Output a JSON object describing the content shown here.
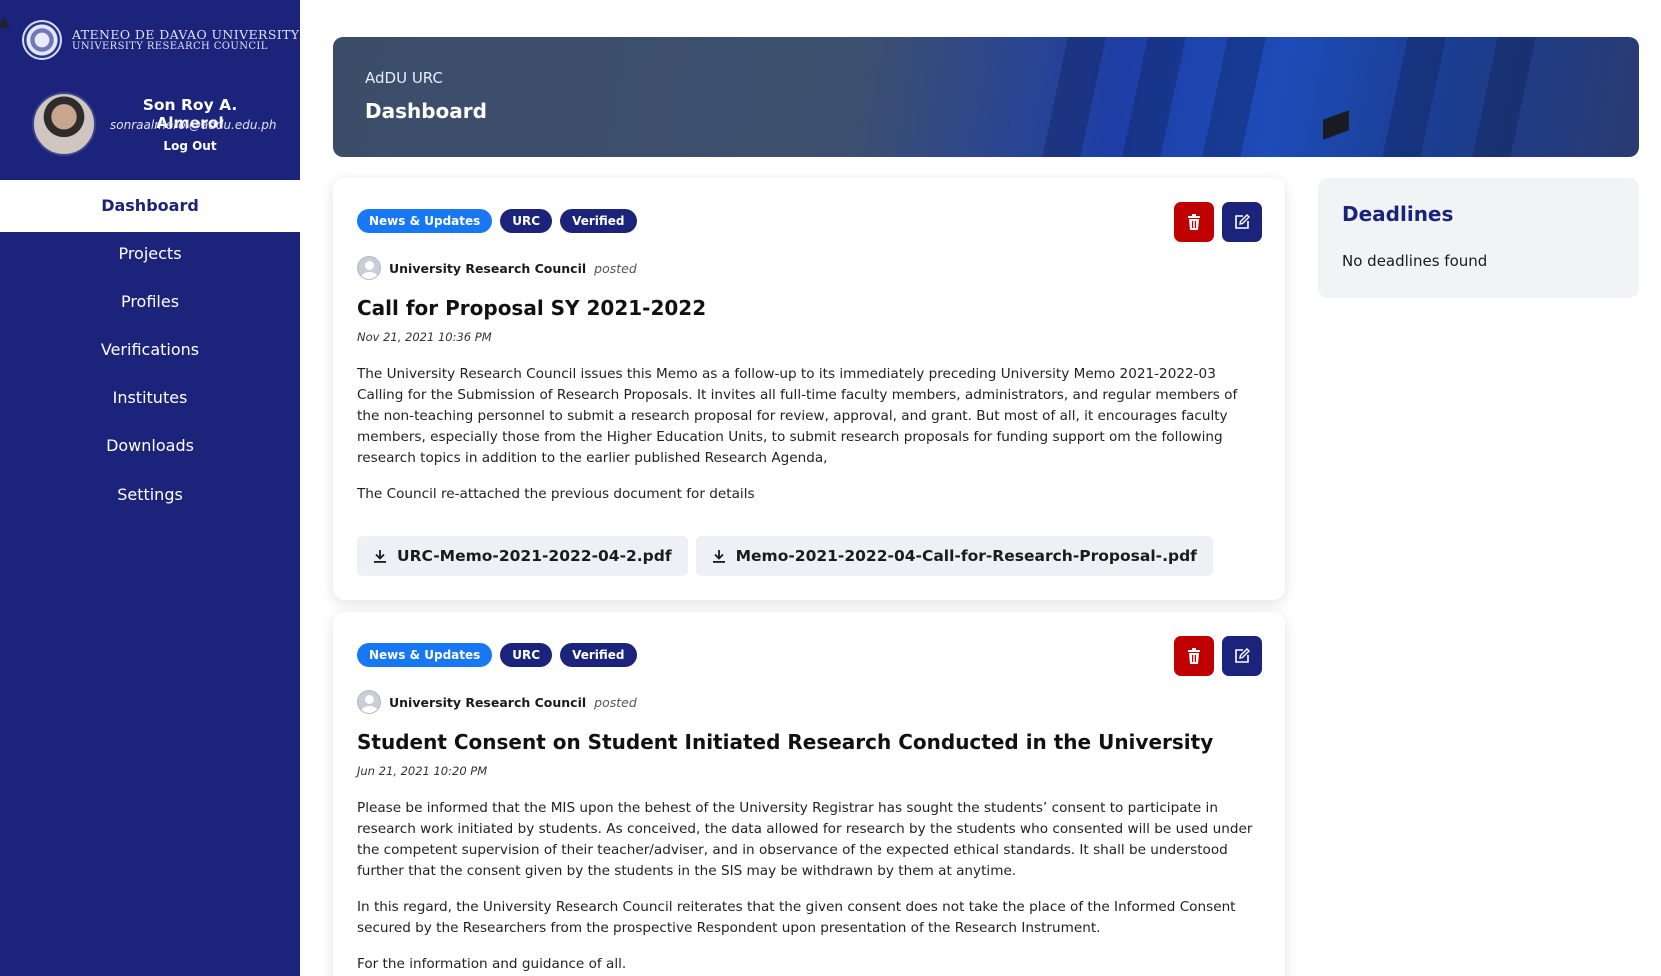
{
  "brand": {
    "line1": "ATENEO DE DAVAO UNIVERSITY",
    "line2": "UNIVERSITY RESEARCH COUNCIL"
  },
  "user": {
    "name": "Son Roy A. Almerol",
    "email": "sonraalmerol@addu.edu.ph",
    "logout_label": "Log Out"
  },
  "nav": {
    "active": "Dashboard",
    "items": [
      "Dashboard",
      "Projects",
      "Profiles",
      "Verifications",
      "Institutes",
      "Downloads",
      "Settings"
    ]
  },
  "banner": {
    "subtitle": "AdDU URC",
    "title": "Dashboard"
  },
  "posts": [
    {
      "badges": [
        "News & Updates",
        "URC",
        "Verified"
      ],
      "poster": "University Research Council",
      "verb": "posted",
      "title": "Call for Proposal SY 2021-2022",
      "date": "Nov 21, 2021 10:36 PM",
      "paragraphs": [
        "The University Research Council issues this Memo as a follow-up to its immediately preceding University Memo 2021-2022-03 Calling for the Submission of Research Proposals. It invites all full-time faculty members, administrators, and regular members of the non-teaching personnel to submit a research proposal for review, approval, and grant. But most of all, it encourages faculty members, especially those from the Higher Education Units, to submit research proposals for funding support om the following research topics in addition to the earlier published Research Agenda,",
        "The Council re-attached the previous document for details"
      ],
      "attachments": [
        "URC-Memo-2021-2022-04-2.pdf",
        "Memo-2021-2022-04-Call-for-Research-Proposal-.pdf"
      ]
    },
    {
      "badges": [
        "News & Updates",
        "URC",
        "Verified"
      ],
      "poster": "University Research Council",
      "verb": "posted",
      "title": "Student Consent on Student Initiated Research Conducted in the University",
      "date": "Jun 21, 2021 10:20 PM",
      "paragraphs": [
        "Please be informed that the MIS upon the behest of the University Registrar has sought the students’ consent to participate in research work initiated by students. As conceived, the data allowed for research by the students who consented will be used under the competent supervision of their teacher/adviser, and in observance of the expected ethical standards. It shall be understood further that the consent given by the students in the SIS may be withdrawn by them at anytime.",
        "In this regard, the University Research Council reiterates that the given consent does not take the place of the Informed Consent secured by the Researchers from the prospective Respondent upon presentation of the Research Instrument.",
        "For the information and guidance of all."
      ],
      "attachments": []
    }
  ],
  "deadlines": {
    "title": "Deadlines",
    "empty_message": "No deadlines found"
  },
  "colors": {
    "primary": "#1b237a",
    "news_badge": "#1877f2",
    "delete": "#c00000",
    "panel_bg": "#f2f3f5"
  },
  "icons": {
    "delete": "trash-icon",
    "edit": "edit-icon",
    "download": "download-icon",
    "poster": "user-avatar-icon"
  }
}
